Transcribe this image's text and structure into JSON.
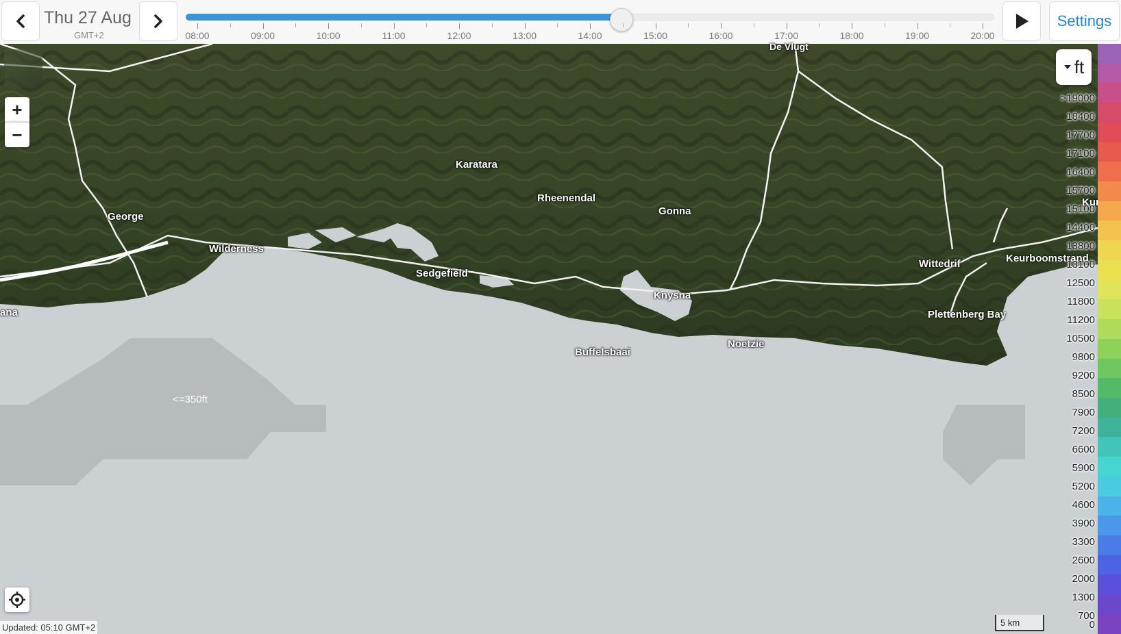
{
  "header": {
    "date": "Thu 27 Aug",
    "timezone": "GMT+2",
    "settings_label": "Settings",
    "prev_icon": "chevron-left-icon",
    "next_icon": "chevron-right-icon",
    "play_icon": "play-icon",
    "slider_progress": 0.539,
    "time_labels": [
      "08:00",
      "09:00",
      "10:00",
      "11:00",
      "12:00",
      "13:00",
      "14:00",
      "15:00",
      "16:00",
      "17:00",
      "18:00",
      "19:00",
      "20:00"
    ]
  },
  "map": {
    "overlay_label": "<=350ft",
    "places": [
      {
        "name": "De Vlugt",
        "small": true
      },
      {
        "name": "Karatara"
      },
      {
        "name": "Rheenendal"
      },
      {
        "name": "George"
      },
      {
        "name": "Gonna"
      },
      {
        "name": "Kurlan"
      },
      {
        "name": "Wilderness"
      },
      {
        "name": "Keurboomstrand"
      },
      {
        "name": "Wittedrif"
      },
      {
        "name": "Sedgefield"
      },
      {
        "name": "Knysna"
      },
      {
        "name": "Plettenberg Bay"
      },
      {
        "name": "ana"
      },
      {
        "name": "Noetzie"
      },
      {
        "name": "Buffelsbaai"
      }
    ],
    "scale_label": "5 km",
    "updated_label": "Updated: 05:10 GMT+2",
    "zoom_in_label": "+",
    "zoom_out_label": "−"
  },
  "legend": {
    "unit": "ft",
    "labels": [
      ">19000",
      "18400",
      "17700",
      "17100",
      "16400",
      "15700",
      "15100",
      "14400",
      "13800",
      "13100",
      "12500",
      "11800",
      "11200",
      "10500",
      "9800",
      "9200",
      "8500",
      "7900",
      "7200",
      "6600",
      "5900",
      "5200",
      "4600",
      "3900",
      "3300",
      "2600",
      "2000",
      "1300",
      "700",
      "0"
    ],
    "colors": [
      "#9a63b8",
      "#b45aa6",
      "#c84f87",
      "#d74a6a",
      "#e24b58",
      "#e85a4e",
      "#ef6e4c",
      "#f28a4c",
      "#f4a74c",
      "#f2c24d",
      "#efd64f",
      "#e8e04f",
      "#dfe45a",
      "#c9e25c",
      "#aedc5a",
      "#8fd25a",
      "#6ec75e",
      "#53bb68",
      "#43b07b",
      "#3fb39a",
      "#42c4b8",
      "#45d6d2",
      "#4acce0",
      "#4cb3e8",
      "#4a97eb",
      "#4a7ce8",
      "#4e63e3",
      "#5a50d9",
      "#6b47cc",
      "#7a43c0"
    ]
  }
}
